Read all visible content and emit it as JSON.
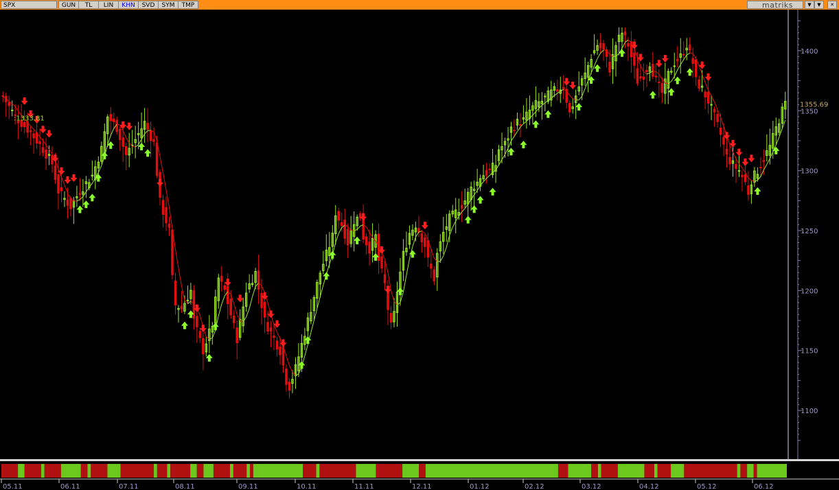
{
  "toolbar": {
    "symbol": "SPX",
    "tabs": [
      {
        "label": "GUN",
        "active": false
      },
      {
        "label": "TL",
        "active": false
      },
      {
        "label": "LIN",
        "active": false
      },
      {
        "label": "KHN",
        "active": true
      },
      {
        "label": "SVD",
        "active": false
      },
      {
        "label": "SYM",
        "active": false
      },
      {
        "label": "TMP",
        "active": false
      }
    ],
    "brand": "matriks",
    "colors": {
      "bar": "#ff8c14",
      "button": "#d4d0c8",
      "active_tab": "#0000ff"
    }
  },
  "chart_data": {
    "type": "candlestick",
    "symbol": "SPX",
    "ylim": [
      1060,
      1432
    ],
    "yticks": [
      1100,
      1150,
      1200,
      1250,
      1300,
      1350,
      1400
    ],
    "x_ticks": [
      "05.11",
      "06.11",
      "07.11",
      "08.11",
      "09.11",
      "10.11",
      "11.11",
      "12.11",
      "01.12",
      "02.12",
      "03.12",
      "04.12",
      "05.12",
      "06.12"
    ],
    "annotations": {
      "left_value": ":1333.81",
      "last_value": "1355.69"
    },
    "price_path": [
      [
        0,
        1362
      ],
      [
        4,
        1345
      ],
      [
        9,
        1332
      ],
      [
        13,
        1318
      ],
      [
        16,
        1306
      ],
      [
        18,
        1283
      ],
      [
        22,
        1270
      ],
      [
        25,
        1283
      ],
      [
        29,
        1296
      ],
      [
        32,
        1318
      ],
      [
        34,
        1345
      ],
      [
        37,
        1336
      ],
      [
        40,
        1313
      ],
      [
        43,
        1326
      ],
      [
        46,
        1340
      ],
      [
        49,
        1323
      ],
      [
        51,
        1274
      ],
      [
        54,
        1250
      ],
      [
        55,
        1210
      ],
      [
        56,
        1188
      ],
      [
        58,
        1185
      ],
      [
        61,
        1200
      ],
      [
        62,
        1175
      ],
      [
        65,
        1150
      ],
      [
        68,
        1172
      ],
      [
        70,
        1210
      ],
      [
        72,
        1200
      ],
      [
        74,
        1180
      ],
      [
        76,
        1160
      ],
      [
        79,
        1200
      ],
      [
        82,
        1215
      ],
      [
        85,
        1175
      ],
      [
        88,
        1160
      ],
      [
        90,
        1150
      ],
      [
        92,
        1125
      ],
      [
        93,
        1120
      ],
      [
        95,
        1135
      ],
      [
        97,
        1155
      ],
      [
        100,
        1185
      ],
      [
        103,
        1215
      ],
      [
        105,
        1230
      ],
      [
        107,
        1245
      ],
      [
        108,
        1265
      ],
      [
        110,
        1255
      ],
      [
        112,
        1240
      ],
      [
        114,
        1258
      ],
      [
        116,
        1262
      ],
      [
        117,
        1245
      ],
      [
        119,
        1235
      ],
      [
        121,
        1245
      ],
      [
        122,
        1225
      ],
      [
        124,
        1205
      ],
      [
        125,
        1185
      ],
      [
        126,
        1170
      ],
      [
        127,
        1180
      ],
      [
        128,
        1200
      ],
      [
        130,
        1230
      ],
      [
        132,
        1248
      ],
      [
        134,
        1255
      ],
      [
        135,
        1250
      ],
      [
        137,
        1238
      ],
      [
        138,
        1225
      ],
      [
        140,
        1210
      ],
      [
        141,
        1230
      ],
      [
        143,
        1248
      ],
      [
        145,
        1260
      ],
      [
        147,
        1265
      ],
      [
        150,
        1275
      ],
      [
        152,
        1285
      ],
      [
        154,
        1290
      ],
      [
        155,
        1295
      ],
      [
        158,
        1300
      ],
      [
        160,
        1305
      ],
      [
        161,
        1318
      ],
      [
        163,
        1322
      ],
      [
        165,
        1335
      ],
      [
        167,
        1340
      ],
      [
        169,
        1342
      ],
      [
        171,
        1350
      ],
      [
        173,
        1355
      ],
      [
        175,
        1358
      ],
      [
        178,
        1365
      ],
      [
        180,
        1368
      ],
      [
        182,
        1370
      ],
      [
        184,
        1348
      ],
      [
        185,
        1355
      ],
      [
        187,
        1370
      ],
      [
        189,
        1380
      ],
      [
        191,
        1395
      ],
      [
        193,
        1405
      ],
      [
        195,
        1400
      ],
      [
        197,
        1385
      ],
      [
        199,
        1405
      ],
      [
        201,
        1415
      ],
      [
        203,
        1405
      ],
      [
        205,
        1385
      ],
      [
        206,
        1375
      ],
      [
        208,
        1380
      ],
      [
        210,
        1390
      ],
      [
        212,
        1375
      ],
      [
        214,
        1365
      ],
      [
        216,
        1380
      ],
      [
        218,
        1390
      ],
      [
        220,
        1395
      ],
      [
        222,
        1405
      ],
      [
        224,
        1390
      ],
      [
        225,
        1375
      ],
      [
        227,
        1368
      ],
      [
        229,
        1358
      ],
      [
        231,
        1345
      ],
      [
        233,
        1330
      ],
      [
        235,
        1312
      ],
      [
        237,
        1305
      ],
      [
        239,
        1300
      ],
      [
        241,
        1290
      ],
      [
        242,
        1282
      ],
      [
        243,
        1292
      ],
      [
        245,
        1300
      ],
      [
        247,
        1310
      ],
      [
        249,
        1320
      ],
      [
        251,
        1335
      ],
      [
        253,
        1350
      ],
      [
        254,
        1355.69
      ]
    ],
    "bottom_band": [
      {
        "color": "red",
        "len": 5
      },
      {
        "color": "green",
        "len": 2
      },
      {
        "color": "red",
        "len": 5
      },
      {
        "color": "green",
        "len": 1
      },
      {
        "color": "red",
        "len": 5
      },
      {
        "color": "green",
        "len": 6
      },
      {
        "color": "red",
        "len": 2
      },
      {
        "color": "green",
        "len": 1
      },
      {
        "color": "red",
        "len": 5
      },
      {
        "color": "green",
        "len": 4
      },
      {
        "color": "red",
        "len": 10
      },
      {
        "color": "green",
        "len": 1
      },
      {
        "color": "red",
        "len": 3
      },
      {
        "color": "green",
        "len": 1
      },
      {
        "color": "red",
        "len": 6
      },
      {
        "color": "green",
        "len": 2
      },
      {
        "color": "red",
        "len": 2
      },
      {
        "color": "green",
        "len": 3
      },
      {
        "color": "red",
        "len": 5
      },
      {
        "color": "green",
        "len": 1
      },
      {
        "color": "red",
        "len": 4
      },
      {
        "color": "green",
        "len": 1
      },
      {
        "color": "red",
        "len": 1
      },
      {
        "color": "green",
        "len": 15
      },
      {
        "color": "red",
        "len": 4
      },
      {
        "color": "green",
        "len": 1
      },
      {
        "color": "red",
        "len": 11
      },
      {
        "color": "green",
        "len": 6
      },
      {
        "color": "red",
        "len": 8
      },
      {
        "color": "green",
        "len": 5
      },
      {
        "color": "red",
        "len": 2
      },
      {
        "color": "green",
        "len": 40
      },
      {
        "color": "red",
        "len": 3
      },
      {
        "color": "green",
        "len": 7
      },
      {
        "color": "red",
        "len": 2
      },
      {
        "color": "green",
        "len": 1
      },
      {
        "color": "red",
        "len": 5
      },
      {
        "color": "green",
        "len": 8
      },
      {
        "color": "red",
        "len": 3
      },
      {
        "color": "green",
        "len": 1
      },
      {
        "color": "red",
        "len": 4
      },
      {
        "color": "green",
        "len": 4
      },
      {
        "color": "red",
        "len": 16
      },
      {
        "color": "green",
        "len": 1
      },
      {
        "color": "red",
        "len": 2
      },
      {
        "color": "green",
        "len": 2
      },
      {
        "color": "red",
        "len": 1
      },
      {
        "color": "green",
        "len": 9
      }
    ],
    "colors": {
      "up": "#9be62a",
      "down": "#e01010",
      "up_arrow": "#8cff2a",
      "down_arrow": "#ff1e1e",
      "band_red": "#b01010",
      "band_green": "#6cc81c",
      "axis": "#8a7bb0",
      "axis_text": "#a095c8",
      "last_value": "#c8a86a",
      "left_value": "#8ee62a"
    }
  }
}
